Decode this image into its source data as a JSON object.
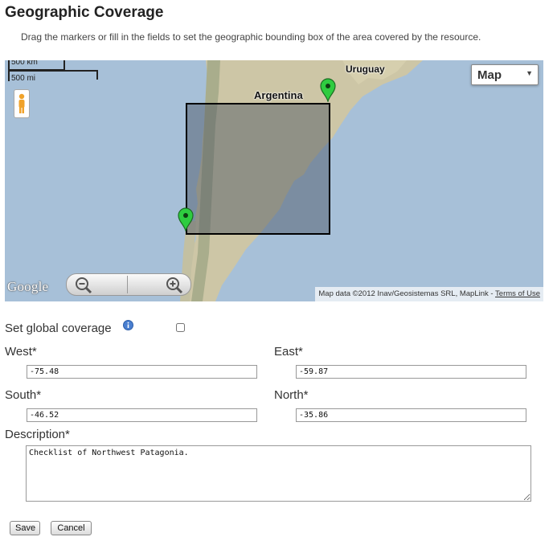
{
  "page": {
    "title": "Geographic Coverage",
    "subtitle": "Drag the markers or fill in the fields to set the geographic bounding box of the area covered by the resource."
  },
  "map": {
    "scale_km": "500 km",
    "scale_mi": "500 mi",
    "type_selector": "Map",
    "labels": {
      "argentina": "Argentina",
      "uruguay": "Uruguay"
    },
    "google_logo": "Google",
    "attribution": "Map data ©2012 Inav/Geosistemas SRL, MapLink - ",
    "terms_link": "Terms of Use",
    "colors": {
      "water": "#a7c0d8",
      "land": "#cdc6a6",
      "marker": "#2ecc40",
      "box_border": "#000000"
    }
  },
  "form": {
    "global_coverage_label": "Set global coverage",
    "global_coverage_checked": false,
    "west_label": "West*",
    "east_label": "East*",
    "south_label": "South*",
    "north_label": "North*",
    "west_value": "-75.48",
    "east_value": "-59.87",
    "south_value": "-46.52",
    "north_value": "-35.86",
    "description_label": "Description*",
    "description_value": "Checklist of Northwest Patagonia."
  },
  "buttons": {
    "save": "Save",
    "cancel": "Cancel"
  }
}
